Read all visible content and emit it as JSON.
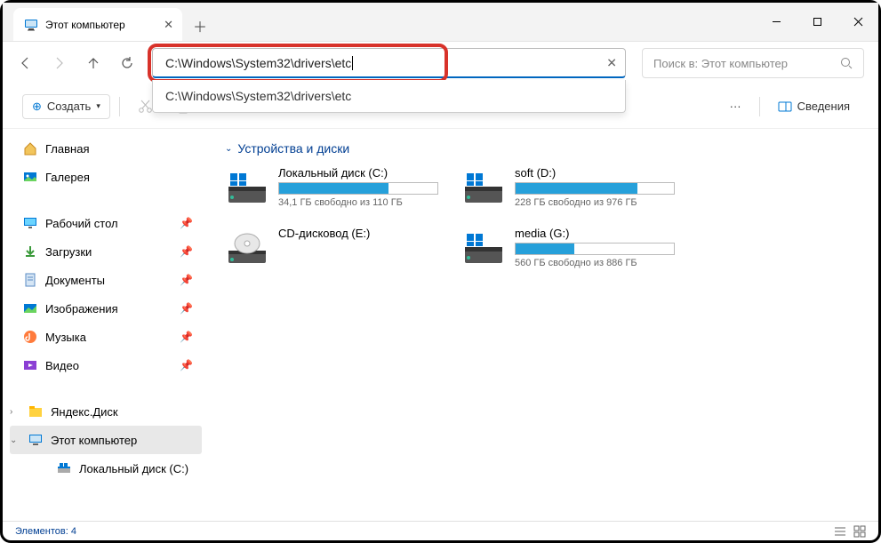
{
  "titlebar": {
    "tab_title": "Этот компьютер"
  },
  "address": {
    "value": "C:\\Windows\\System32\\drivers\\etc",
    "suggestion": "C:\\Windows\\System32\\drivers\\etc"
  },
  "search": {
    "placeholder": "Поиск в: Этот компьютер"
  },
  "toolbar": {
    "create": "Создать",
    "more": "···",
    "details": "Сведения"
  },
  "sidebar": {
    "home": "Главная",
    "gallery": "Галерея",
    "desktop": "Рабочий стол",
    "downloads": "Загрузки",
    "documents": "Документы",
    "pictures": "Изображения",
    "music": "Музыка",
    "videos": "Видео",
    "yadisk": "Яндекс.Диск",
    "thispc": "Этот компьютер",
    "localc": "Локальный диск (C:)"
  },
  "content": {
    "section": "Устройства и диски",
    "drives": [
      {
        "name": "Локальный диск (C:)",
        "free": "34,1 ГБ свободно из 110 ГБ",
        "fill": 69,
        "type": "hdd"
      },
      {
        "name": "soft (D:)",
        "free": "228 ГБ свободно из 976 ГБ",
        "fill": 77,
        "type": "hdd"
      },
      {
        "name": "CD-дисковод (E:)",
        "free": "",
        "fill": 0,
        "type": "cd"
      },
      {
        "name": "media (G:)",
        "free": "560 ГБ свободно из 886 ГБ",
        "fill": 37,
        "type": "hdd"
      }
    ]
  },
  "status": {
    "count": "Элементов: 4"
  }
}
